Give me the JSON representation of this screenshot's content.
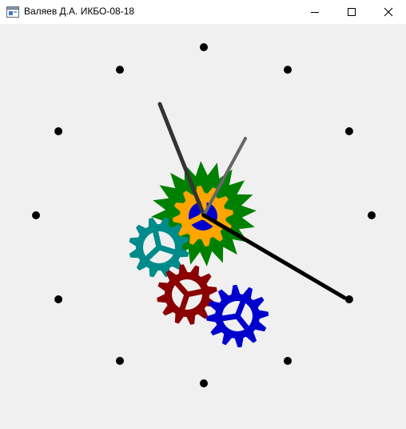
{
  "window": {
    "title": "Валяев Д.А. ИКБО-08-18",
    "controls": {
      "minimize_icon": "minimize-icon",
      "maximize_icon": "maximize-icon",
      "close_icon": "close-icon"
    }
  },
  "clock": {
    "marker_count": 12,
    "marker_color": "#000000",
    "hands": {
      "hour_color": "#333333",
      "minute_color": "#000000",
      "second_color": "#666666"
    }
  },
  "gears": [
    {
      "name": "green-gear",
      "color": "#008000",
      "teeth": 20
    },
    {
      "name": "orange-gear",
      "color": "#ffa500",
      "teeth": 12
    },
    {
      "name": "teal-gear",
      "color": "#008b8b",
      "teeth": 12
    },
    {
      "name": "red-gear",
      "color": "#8b0000",
      "teeth": 12
    },
    {
      "name": "blue-gear",
      "color": "#0000cd",
      "teeth": 12
    }
  ]
}
